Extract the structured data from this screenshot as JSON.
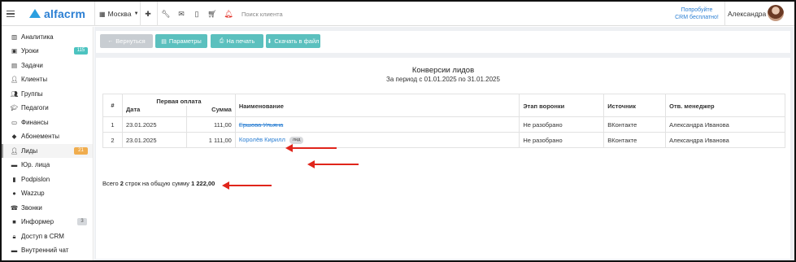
{
  "topbar": {
    "logo": "alfacrm",
    "branch": "Москва",
    "branch_icon": "building-icon",
    "search_placeholder": "Поиск клиента",
    "promo_line1": "Попробуйте",
    "promo_line2": "CRM бесплатно!",
    "username": "Александра"
  },
  "sidebar": {
    "items": [
      {
        "label": "Аналитика",
        "icon": "chart-icon"
      },
      {
        "label": "Уроки",
        "icon": "calendar-icon",
        "badge": "115",
        "badge_color": "#4cc3c0"
      },
      {
        "label": "Задачи",
        "icon": "tasks-icon"
      },
      {
        "label": "Клиенты",
        "icon": "user-icon"
      },
      {
        "label": "Группы",
        "icon": "group-icon"
      },
      {
        "label": "Педагоги",
        "icon": "teacher-icon"
      },
      {
        "label": "Финансы",
        "icon": "money-icon"
      },
      {
        "label": "Абонементы",
        "icon": "tag-icon"
      },
      {
        "label": "Лиды",
        "icon": "lead-icon",
        "badge": "21",
        "badge_color": "#f0ad4e",
        "active": true
      },
      {
        "label": "Юр. лица",
        "icon": "briefcase-icon"
      },
      {
        "label": "Podpislon",
        "icon": "document-icon"
      },
      {
        "label": "Wazzup",
        "icon": "whatsapp-icon"
      },
      {
        "label": "Звонки",
        "icon": "phone-icon"
      },
      {
        "label": "Информер",
        "icon": "informer-icon",
        "badge": "3",
        "badge_color": "#d5d8dc"
      },
      {
        "label": "Доступ в CRM",
        "icon": "lock-icon"
      },
      {
        "label": "Внутренний чат",
        "icon": "chat-icon"
      }
    ]
  },
  "toolbar": {
    "back_label": "Вернуться",
    "params_label": "Параметры",
    "print_label": "На печать",
    "download_label": "Скачать в файл"
  },
  "report": {
    "title": "Конверсии лидов",
    "subtitle": "За период с 01.01.2025 по 31.01.2025",
    "headers": {
      "num": "#",
      "first_payment": "Первая оплата",
      "date": "Дата",
      "sum": "Сумма",
      "name": "Наименование",
      "stage": "Этап воронки",
      "source": "Источник",
      "manager": "Отв. менеджер"
    },
    "rows": [
      {
        "num": "1",
        "date": "23.01.2025",
        "sum": "111,00",
        "name": "Ершова Ульяна",
        "tag": "",
        "stage": "Не разобрано",
        "source": "ВКонтакте",
        "manager": "Александра Иванова"
      },
      {
        "num": "2",
        "date": "23.01.2025",
        "sum": "1 111,00",
        "name": "Королёв Кирилл",
        "tag": "лид",
        "stage": "Не разобрано",
        "source": "ВКонтакте",
        "manager": "Александра Иванова"
      }
    ],
    "total_prefix": "Всего ",
    "total_rows": "2",
    "total_middle": " строк на общую сумму ",
    "total_sum": "1 222,00"
  },
  "colors": {
    "accent": "#2b7fd3",
    "btn_disabled": "#c8cdd2",
    "btn_teal": "#5bc0be",
    "annotation_arrow": "#e0251b"
  }
}
